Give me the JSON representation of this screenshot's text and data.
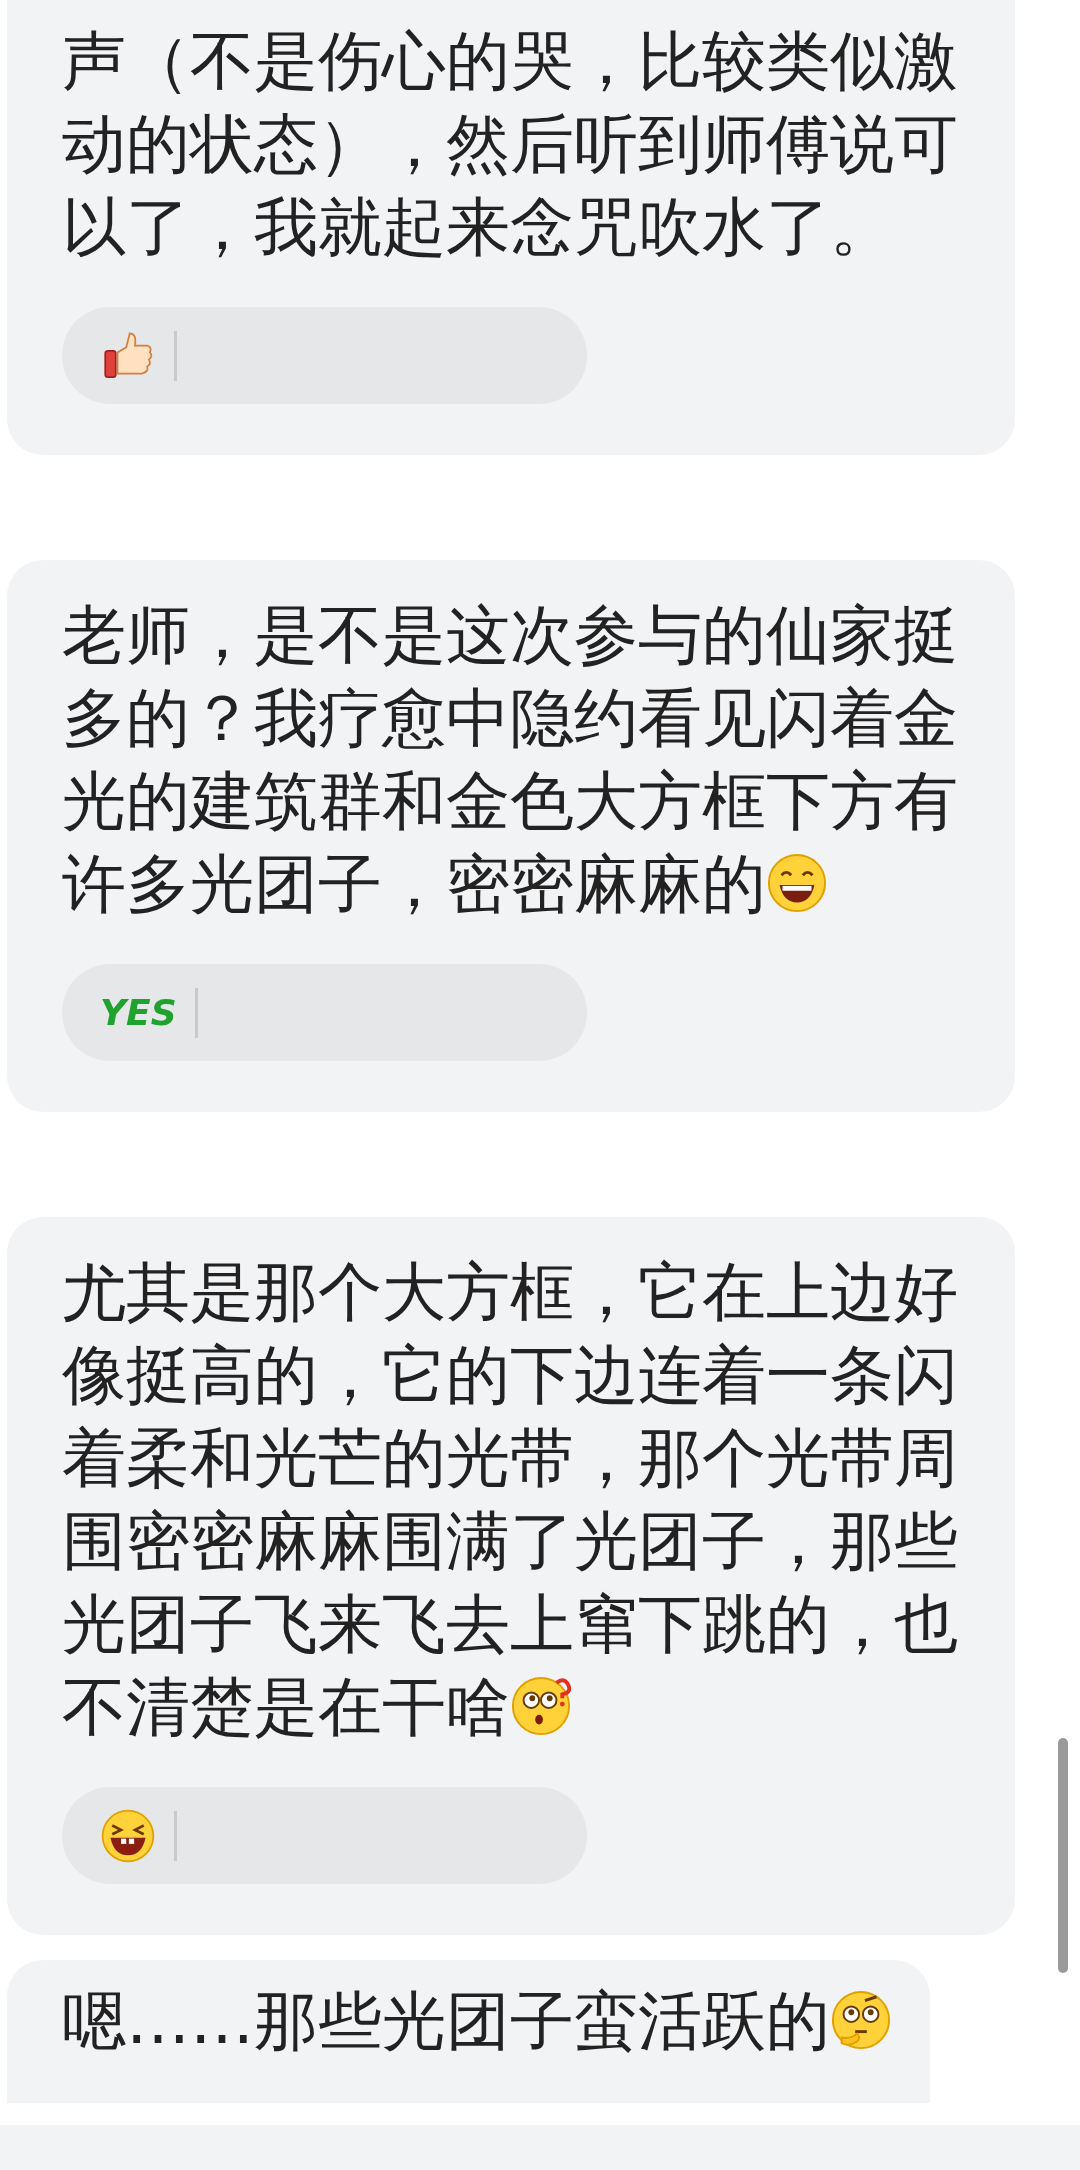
{
  "messages": [
    {
      "text": "声（不是伤心的哭，比较类似激动的状态），然后听到师傅说可以了，我就起来念咒吹水了。",
      "reaction": {
        "kind": "thumbs-up"
      }
    },
    {
      "text": "老师，是不是这次参与的仙家挺多的？我疗愈中隐约看见闪着金光的建筑群和金色大方框下方有许多光团子，密密麻麻的",
      "trailing_emoji": {
        "kind": "grin"
      },
      "reaction": {
        "kind": "text",
        "label": "YES"
      }
    },
    {
      "text": "尤其是那个大方框，它在上边好像挺高的，它的下边连着一条闪着柔和光芒的光带，那个光带周围密密麻麻围满了光团子，那些光团子飞来飞去上窜下跳的，也不清楚是在干啥",
      "trailing_emoji": {
        "kind": "puzzled"
      },
      "reaction": {
        "kind": "laugh"
      }
    },
    {
      "text": "嗯……那些光团子蛮活跃的",
      "trailing_emoji": {
        "kind": "thinking"
      }
    }
  ]
}
